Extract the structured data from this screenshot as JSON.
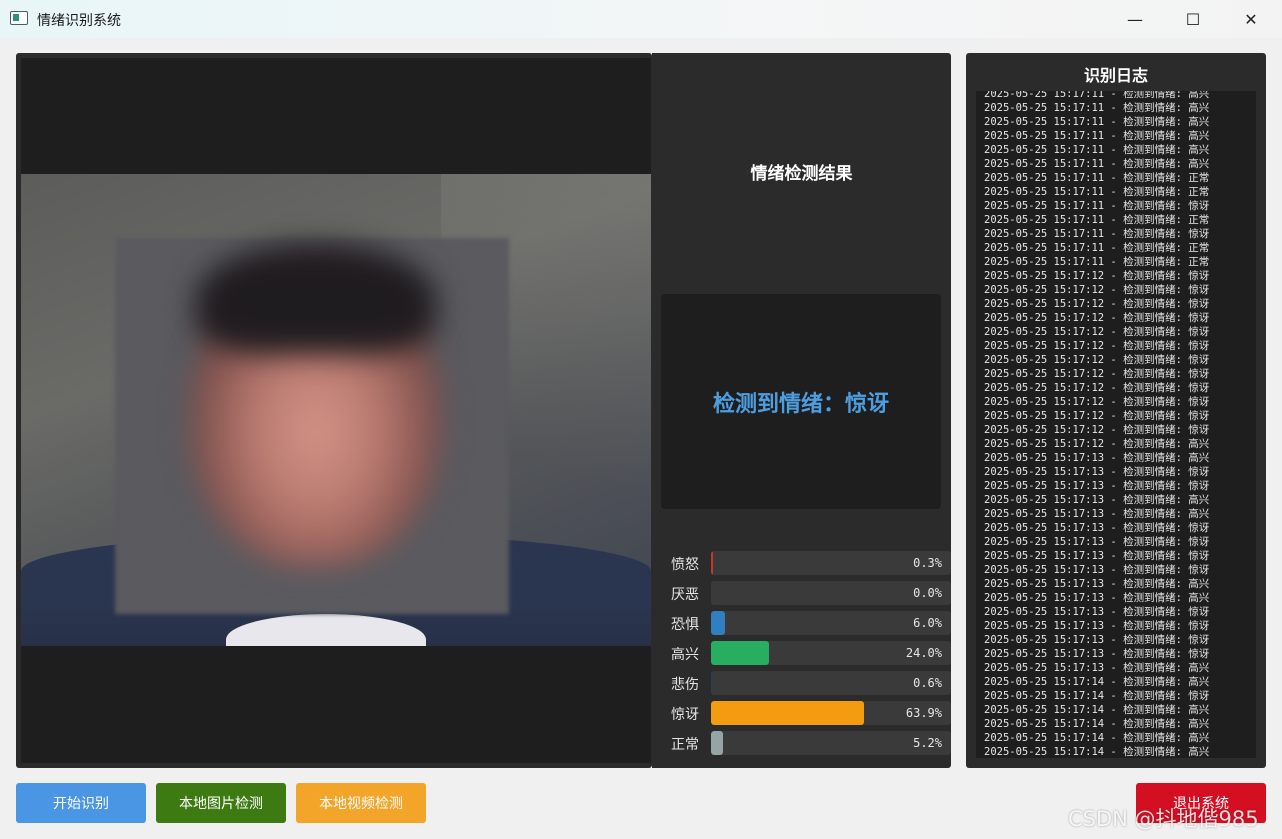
{
  "window": {
    "title": "情绪识别系统",
    "minimize_glyph": "—",
    "maximize_glyph": "☐",
    "close_glyph": "✕"
  },
  "result": {
    "title": "情绪检测结果",
    "detected_text": "检测到情绪：惊讶",
    "detected_color": "#4d9ee0"
  },
  "emotions": [
    {
      "label": "愤怒",
      "value": 0.003,
      "display": "0.3%",
      "color": "#c0392b"
    },
    {
      "label": "厌恶",
      "value": 0.0,
      "display": "0.0%",
      "color": "#8e44ad"
    },
    {
      "label": "恐惧",
      "value": 0.06,
      "display": "6.0%",
      "color": "#2f7fc1"
    },
    {
      "label": "高兴",
      "value": 0.24,
      "display": "24.0%",
      "color": "#27ae60"
    },
    {
      "label": "悲伤",
      "value": 0.006,
      "display": "0.6%",
      "color": "#2c3e50"
    },
    {
      "label": "惊讶",
      "value": 0.639,
      "display": "63.9%",
      "color": "#f39c12"
    },
    {
      "label": "正常",
      "value": 0.052,
      "display": "5.2%",
      "color": "#95a5a6"
    }
  ],
  "log": {
    "title": "识别日志",
    "entries": [
      "2025-05-25 15:17:11 - 检测到情绪: 高兴",
      "2025-05-25 15:17:11 - 检测到情绪: 高兴",
      "2025-05-25 15:17:11 - 检测到情绪: 高兴",
      "2025-05-25 15:17:11 - 检测到情绪: 高兴",
      "2025-05-25 15:17:11 - 检测到情绪: 高兴",
      "2025-05-25 15:17:11 - 检测到情绪: 高兴",
      "2025-05-25 15:17:11 - 检测到情绪: 正常",
      "2025-05-25 15:17:11 - 检测到情绪: 正常",
      "2025-05-25 15:17:11 - 检测到情绪: 惊讶",
      "2025-05-25 15:17:11 - 检测到情绪: 正常",
      "2025-05-25 15:17:11 - 检测到情绪: 惊讶",
      "2025-05-25 15:17:11 - 检测到情绪: 正常",
      "2025-05-25 15:17:11 - 检测到情绪: 正常",
      "2025-05-25 15:17:12 - 检测到情绪: 惊讶",
      "2025-05-25 15:17:12 - 检测到情绪: 惊讶",
      "2025-05-25 15:17:12 - 检测到情绪: 惊讶",
      "2025-05-25 15:17:12 - 检测到情绪: 惊讶",
      "2025-05-25 15:17:12 - 检测到情绪: 惊讶",
      "2025-05-25 15:17:12 - 检测到情绪: 惊讶",
      "2025-05-25 15:17:12 - 检测到情绪: 惊讶",
      "2025-05-25 15:17:12 - 检测到情绪: 惊讶",
      "2025-05-25 15:17:12 - 检测到情绪: 惊讶",
      "2025-05-25 15:17:12 - 检测到情绪: 惊讶",
      "2025-05-25 15:17:12 - 检测到情绪: 惊讶",
      "2025-05-25 15:17:12 - 检测到情绪: 惊讶",
      "2025-05-25 15:17:12 - 检测到情绪: 高兴",
      "2025-05-25 15:17:13 - 检测到情绪: 高兴",
      "2025-05-25 15:17:13 - 检测到情绪: 惊讶",
      "2025-05-25 15:17:13 - 检测到情绪: 惊讶",
      "2025-05-25 15:17:13 - 检测到情绪: 高兴",
      "2025-05-25 15:17:13 - 检测到情绪: 高兴",
      "2025-05-25 15:17:13 - 检测到情绪: 惊讶",
      "2025-05-25 15:17:13 - 检测到情绪: 惊讶",
      "2025-05-25 15:17:13 - 检测到情绪: 惊讶",
      "2025-05-25 15:17:13 - 检测到情绪: 惊讶",
      "2025-05-25 15:17:13 - 检测到情绪: 高兴",
      "2025-05-25 15:17:13 - 检测到情绪: 高兴",
      "2025-05-25 15:17:13 - 检测到情绪: 惊讶",
      "2025-05-25 15:17:13 - 检测到情绪: 惊讶",
      "2025-05-25 15:17:13 - 检测到情绪: 惊讶",
      "2025-05-25 15:17:13 - 检测到情绪: 惊讶",
      "2025-05-25 15:17:13 - 检测到情绪: 高兴",
      "2025-05-25 15:17:14 - 检测到情绪: 高兴",
      "2025-05-25 15:17:14 - 检测到情绪: 惊讶",
      "2025-05-25 15:17:14 - 检测到情绪: 高兴",
      "2025-05-25 15:17:14 - 检测到情绪: 高兴",
      "2025-05-25 15:17:14 - 检测到情绪: 高兴",
      "2025-05-25 15:17:14 - 检测到情绪: 高兴",
      "2025-05-25 15:17:14 - 检测到情绪: 惊讶"
    ]
  },
  "buttons": {
    "start": "开始识别",
    "image": "本地图片检测",
    "video": "本地视频检测",
    "exit": "退出系统"
  },
  "watermark": "CSDN @抖地偕985"
}
